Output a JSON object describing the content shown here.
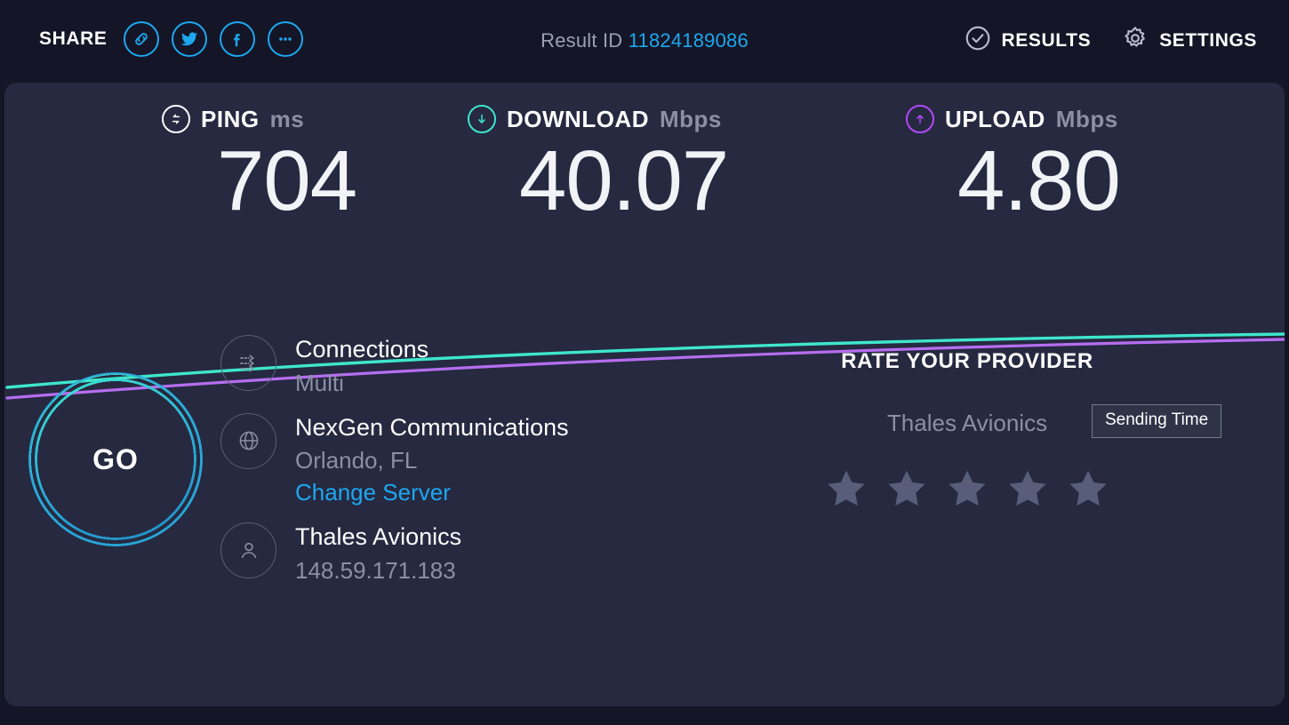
{
  "header": {
    "share_label": "SHARE",
    "share_icons": [
      {
        "name": "link-icon"
      },
      {
        "name": "twitter-icon"
      },
      {
        "name": "facebook-icon"
      },
      {
        "name": "more-icon"
      }
    ],
    "result_id_label": "Result ID",
    "result_id_value": "11824189086",
    "results_label": "RESULTS",
    "settings_label": "SETTINGS"
  },
  "metrics": {
    "ping": {
      "name": "PING",
      "unit": "ms",
      "value": "704",
      "icon": "ping-icon",
      "color": "#ffffff"
    },
    "download": {
      "name": "DOWNLOAD",
      "unit": "Mbps",
      "value": "40.07",
      "icon": "download-icon",
      "color": "#3ee6cd"
    },
    "upload": {
      "name": "UPLOAD",
      "unit": "Mbps",
      "value": "4.80",
      "icon": "upload-icon",
      "color": "#b249f8"
    }
  },
  "graph": {
    "tooltip_label": "Sending Time",
    "download_color": "#3ee6cd",
    "upload_color": "#b66ef0"
  },
  "go_button": {
    "label": "GO"
  },
  "info": {
    "rows": [
      {
        "icon": "connections-icon",
        "title": "Connections",
        "sub": "Multi"
      },
      {
        "icon": "globe-icon",
        "title": "NexGen Communications",
        "sub": "Orlando, FL",
        "link": "Change Server"
      },
      {
        "icon": "user-icon",
        "title": "Thales Avionics",
        "sub": "148.59.171.183"
      }
    ]
  },
  "rate_provider": {
    "title": "RATE YOUR PROVIDER",
    "isp": "Thales Avionics",
    "stars": 5,
    "filled": 0,
    "star_color": "#585d7a"
  },
  "colors": {
    "background": "#141627",
    "panel": "#262940",
    "accent_blue": "#1da7ef",
    "teal": "#3ee6cd",
    "purple": "#b249f8"
  }
}
